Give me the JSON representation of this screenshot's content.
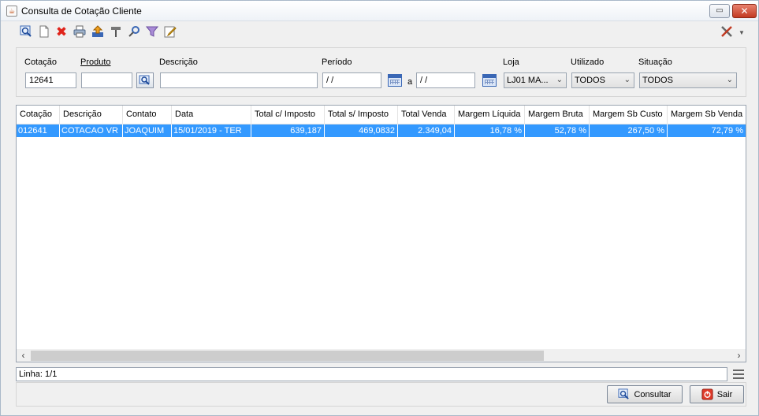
{
  "window": {
    "title": "Consulta de Cotação Cliente",
    "restore_glyph": "▭",
    "close_glyph": "✕"
  },
  "toolbar": {
    "icons": [
      "search-icon",
      "new-document-icon",
      "delete-icon",
      "print-icon",
      "export-icon",
      "tools-icon",
      "key-icon",
      "filter-icon",
      "edit-icon"
    ],
    "close_glyph": "✖"
  },
  "filters": {
    "cotacao": {
      "label": "Cotação",
      "value": "12641"
    },
    "produto": {
      "label": "Produto",
      "value": ""
    },
    "descricao": {
      "label": "Descrição",
      "value": ""
    },
    "periodo": {
      "label": "Período",
      "start": " / /",
      "separator": "a",
      "end": " / /"
    },
    "loja": {
      "label": "Loja",
      "value": "LJ01 MA..."
    },
    "utilizado": {
      "label": "Utilizado",
      "value": "TODOS"
    },
    "situacao": {
      "label": "Situação",
      "value": "TODOS"
    }
  },
  "grid": {
    "columns": [
      "Cotação",
      "Descrição",
      "Contato",
      "Data",
      "Total c/ Imposto",
      "Total s/ Imposto",
      "Total Venda",
      "Margem Líquida",
      "Margem Bruta",
      "Margem Sb Custo",
      "Margem Sb Venda"
    ],
    "rows": [
      [
        "012641",
        "COTACAO VR",
        "JOAQUIM",
        "15/01/2019 - TER",
        "639,187",
        "469,0832",
        "2.349,04",
        "16,78 %",
        "52,78 %",
        "267,50 %",
        "72,79 %"
      ]
    ]
  },
  "status": {
    "text": "Linha: 1/1"
  },
  "buttons": {
    "consultar": "Consultar",
    "sair": "Sair"
  }
}
